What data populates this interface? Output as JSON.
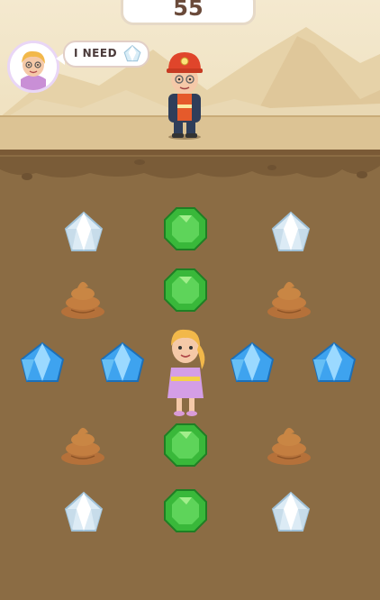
{
  "hud": {
    "score": "55",
    "request_label": "I NEED",
    "request_item": "diamond"
  },
  "colors": {
    "dirt": "#8b6c44",
    "ground": "#dcc394",
    "sky": "#f4e9cf"
  },
  "grid": {
    "rows": [
      [
        "diamond",
        "emerald",
        "diamond"
      ],
      [
        "poop",
        "emerald",
        "poop"
      ],
      [
        "sapphire",
        "sapphire",
        "girl",
        "sapphire",
        "sapphire"
      ],
      [
        "poop",
        "emerald",
        "poop"
      ],
      [
        "diamond",
        "emerald",
        "diamond"
      ]
    ]
  }
}
